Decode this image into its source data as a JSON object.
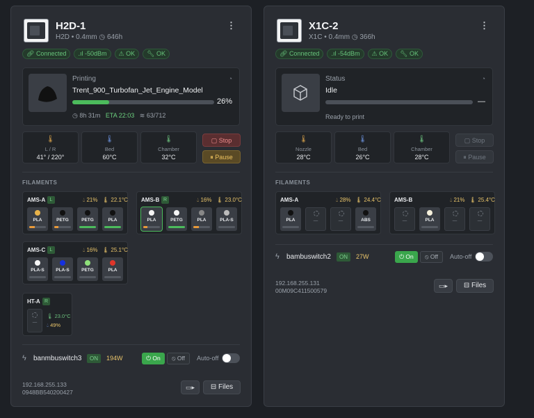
{
  "p1": {
    "name": "H2D-1",
    "model": "H2D",
    "nozzle": "0.4mm",
    "hours": "646h",
    "chips": [
      "Connected",
      "-50dBm",
      "OK",
      "OK"
    ],
    "job_label": "Printing",
    "job_name": "Trent_900_Turbofan_Jet_Engine_Model",
    "progress": 26,
    "progress_text": "26%",
    "remaining": "8h 31m",
    "eta": "ETA 22:03",
    "layers": "63/712",
    "temps": [
      {
        "label": "L / R",
        "value": "41° / 220°"
      },
      {
        "label": "Bed",
        "value": "60°C"
      },
      {
        "label": "Chamber",
        "value": "32°C"
      }
    ],
    "stop": "Stop",
    "pause": "Pause",
    "filaments_title": "FILAMENTS",
    "ams": [
      {
        "name": "AMS-A",
        "badge": "L",
        "hum": "21%",
        "temp": "22.1°C",
        "slots": [
          {
            "t": "PLA",
            "c": "#e8b34a",
            "f": 0.35,
            "fc": "#e89a3a"
          },
          {
            "t": "PETG",
            "c": "#111111",
            "f": 0.25,
            "fc": "#e89a3a"
          },
          {
            "t": "PETG",
            "c": "#111111",
            "f": 1.0,
            "fc": "#4cbb5c"
          },
          {
            "t": "PLA",
            "c": "#111111",
            "f": 1.0,
            "fc": "#4cbb5c"
          }
        ]
      },
      {
        "name": "AMS-B",
        "badge": "R",
        "hum": "16%",
        "temp": "23.0°C",
        "slots": [
          {
            "t": "PLA",
            "c": "#f5f5f5",
            "f": 0.25,
            "fc": "#e89a3a",
            "sel": true
          },
          {
            "t": "PETG",
            "c": "#f5f5f5",
            "f": 1.0,
            "fc": "#4cbb5c"
          },
          {
            "t": "PLA",
            "c": "#888888",
            "f": 0.35,
            "fc": "#e89a3a"
          },
          {
            "t": "PLA-S",
            "c": "#bbbbbb",
            "f": 0,
            "fc": "#4cbb5c"
          }
        ]
      },
      {
        "name": "AMS-C",
        "badge": "L",
        "hum": "16%",
        "temp": "25.1°C",
        "slots": [
          {
            "t": "PLA-S",
            "c": "#f5f5f5",
            "f": 0,
            "fc": "#4cbb5c"
          },
          {
            "t": "PLA-S",
            "c": "#1530e0",
            "f": 0,
            "fc": "#4cbb5c"
          },
          {
            "t": "PETG",
            "c": "#8fe07a",
            "f": 0,
            "fc": "#4cbb5c"
          },
          {
            "t": "PLA",
            "c": "#e0352a",
            "f": 0,
            "fc": "#4cbb5c"
          }
        ]
      }
    ],
    "ht": {
      "name": "HT-A",
      "badge": "R",
      "slot": "—",
      "temp": "23.0°C",
      "hum": "49%"
    },
    "switch": {
      "name": "banmbuswitch3",
      "state": "ON",
      "watts": "194W",
      "on": "On",
      "off": "Off",
      "auto": "Auto-off"
    },
    "ip": "192.168.255.133",
    "serial": "0948BB540200427",
    "files": "Files"
  },
  "p2": {
    "name": "X1C-2",
    "model": "X1C",
    "nozzle": "0.4mm",
    "hours": "366h",
    "chips": [
      "Connected",
      "-54dBm",
      "OK",
      "OK"
    ],
    "job_label": "Status",
    "job_name": "Idle",
    "progress": 0,
    "progress_text": "—",
    "job_sub": "Ready to print",
    "temps": [
      {
        "label": "Nozzle",
        "value": "28°C"
      },
      {
        "label": "Bed",
        "value": "26°C"
      },
      {
        "label": "Chamber",
        "value": "28°C"
      }
    ],
    "stop": "Stop",
    "pause": "Pause",
    "filaments_title": "FILAMENTS",
    "ams": [
      {
        "name": "AMS-A",
        "badge": "",
        "hum": "28%",
        "temp": "24.4°C",
        "slots": [
          {
            "t": "PLA",
            "c": "#111111"
          },
          {
            "t": "—",
            "e": true
          },
          {
            "t": "—",
            "e": true
          },
          {
            "t": "ABS",
            "c": "#111111"
          }
        ]
      },
      {
        "name": "AMS-B",
        "badge": "",
        "hum": "21%",
        "temp": "25.4°C",
        "slots": [
          {
            "t": "—",
            "e": true
          },
          {
            "t": "PLA",
            "c": "#f5f0dc"
          },
          {
            "t": "—",
            "e": true
          },
          {
            "t": "—",
            "e": true
          }
        ]
      }
    ],
    "switch": {
      "name": "bambuswitch2",
      "state": "ON",
      "watts": "27W",
      "on": "On",
      "off": "Off",
      "auto": "Auto-off"
    },
    "ip": "192.168.255.131",
    "serial": "00M09C411500579",
    "files": "Files"
  },
  "icons": [
    "kebab-icon",
    "clock-icon",
    "layers-icon",
    "thermometer-icon",
    "droplet-icon",
    "bolt-icon",
    "power-icon",
    "camera-icon",
    "folder-icon",
    "cube-icon"
  ]
}
